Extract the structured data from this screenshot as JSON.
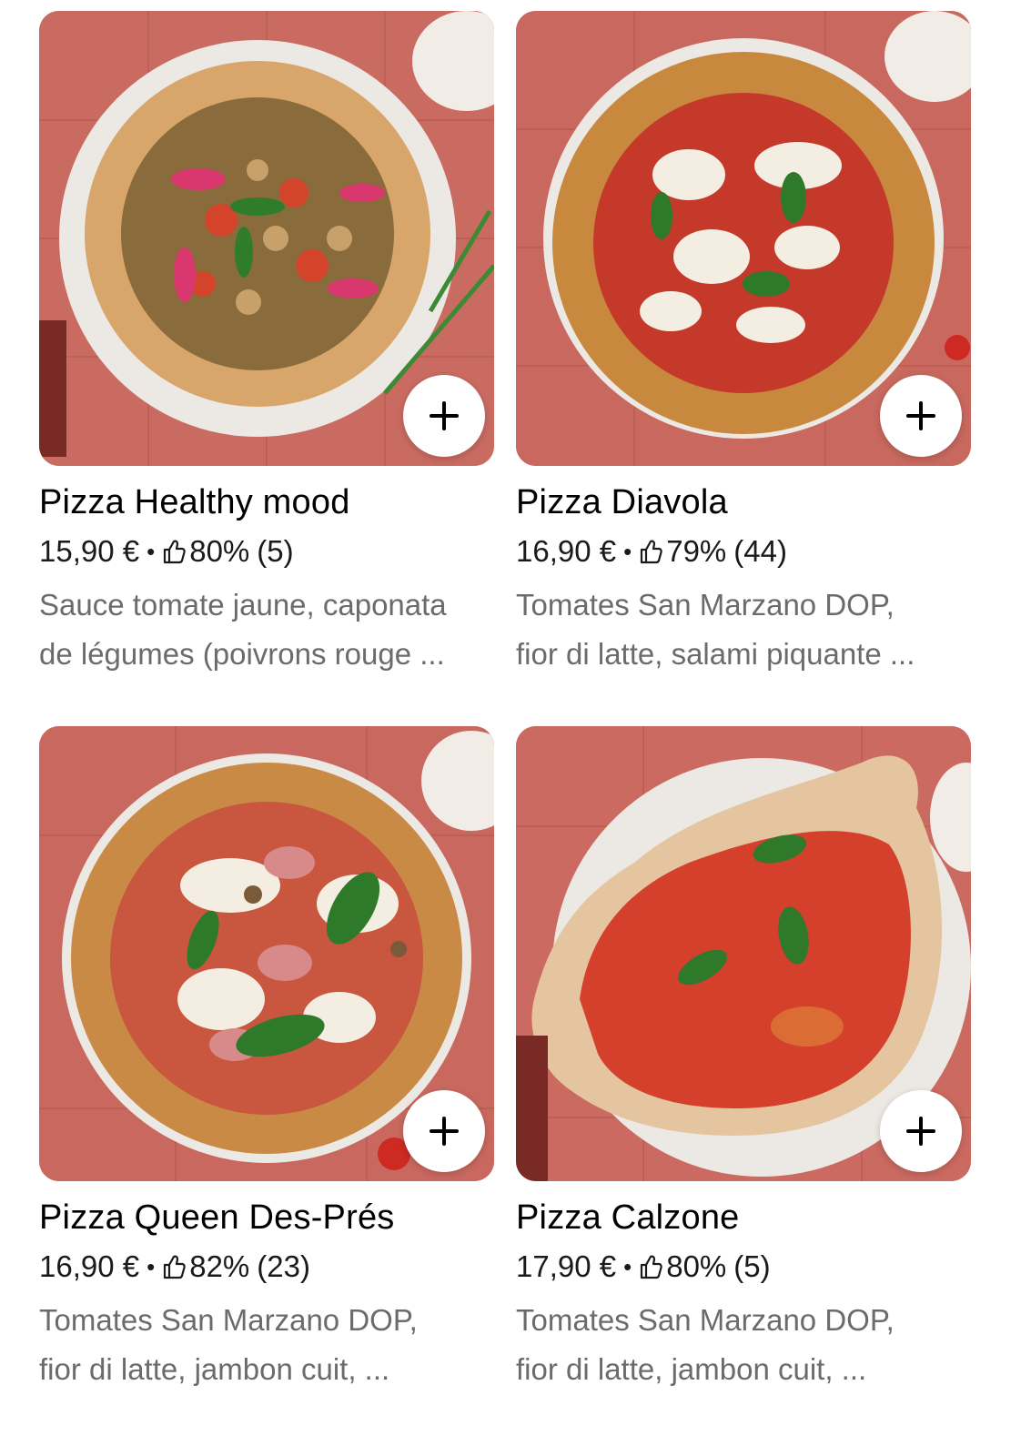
{
  "items": [
    {
      "name": "Pizza Healthy mood",
      "price": "15,90 €",
      "separator": "•",
      "rating": "80%",
      "reviews": "(5)",
      "desc_line1": "Sauce tomate jaune, caponata",
      "desc_line2": "de légumes (poivrons rouge ...",
      "photo": "pizza-healthy-mood-photo"
    },
    {
      "name": "Pizza Diavola",
      "price": "16,90 €",
      "separator": "•",
      "rating": "79%",
      "reviews": "(44)",
      "desc_line1": "Tomates San Marzano DOP,",
      "desc_line2": "fior di latte, salami piquante ...",
      "photo": "pizza-diavola-photo"
    },
    {
      "name": "Pizza Queen Des-Prés",
      "price": "16,90 €",
      "separator": "•",
      "rating": "82%",
      "reviews": "(23)",
      "desc_line1": "Tomates San Marzano DOP,",
      "desc_line2": "fior di latte, jambon cuit, ...",
      "photo": "pizza-queen-photo"
    },
    {
      "name": "Pizza Calzone",
      "price": "17,90 €",
      "separator": "•",
      "rating": "80%",
      "reviews": "(5)",
      "desc_line1": "Tomates San Marzano DOP,",
      "desc_line2": "fior di latte, jambon cuit, ...",
      "photo": "pizza-calzone-photo"
    }
  ],
  "icons": {
    "add": "plus-icon",
    "rating": "thumbs-up-icon"
  },
  "colors": {
    "background": "#ffffff",
    "text": "#000000",
    "secondary_text": "#6b6b6b",
    "tile_background": "#c9675d"
  }
}
